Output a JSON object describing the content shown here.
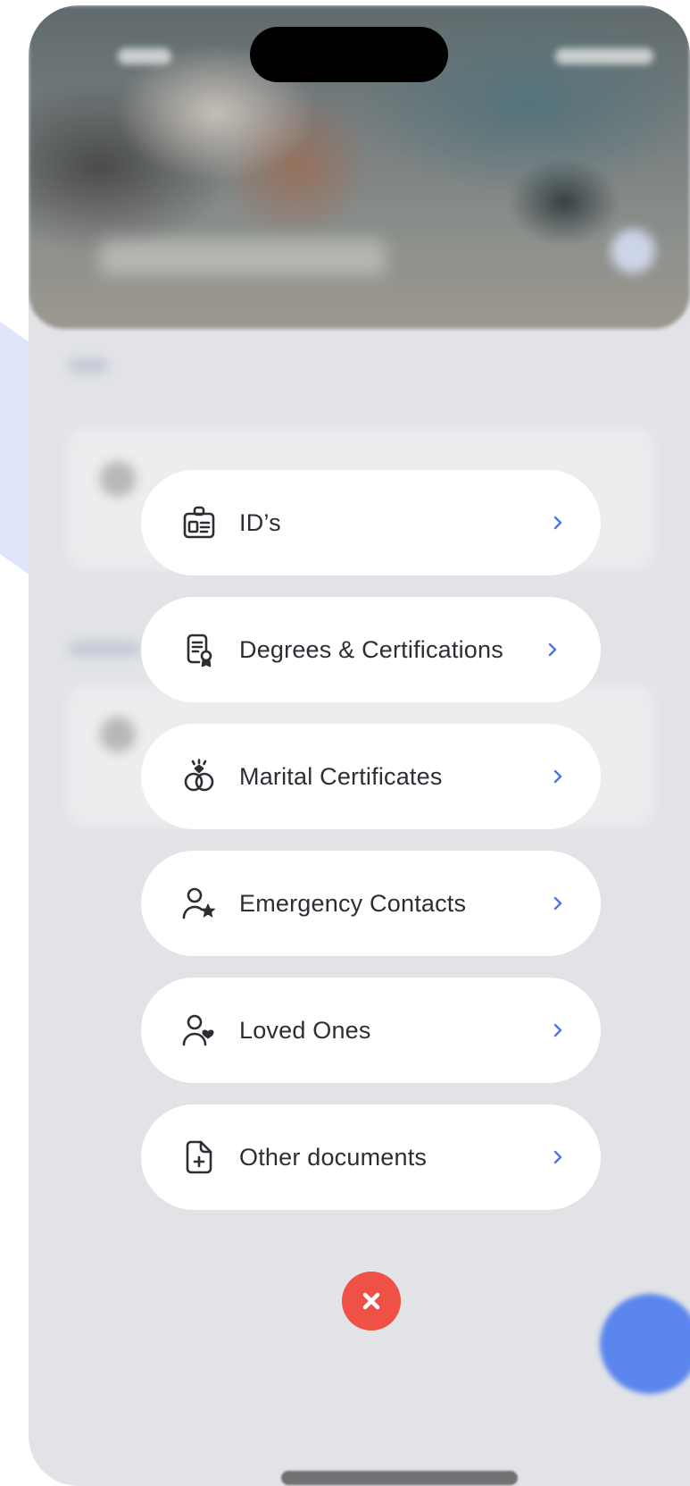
{
  "menu": {
    "items": [
      {
        "label": "ID’s",
        "icon": "id-badge-icon"
      },
      {
        "label": "Degrees & Certifications",
        "icon": "certificate-icon"
      },
      {
        "label": "Marital Certificates",
        "icon": "rings-icon"
      },
      {
        "label": "Emergency Contacts",
        "icon": "person-star-icon"
      },
      {
        "label": "Loved Ones",
        "icon": "person-heart-icon"
      },
      {
        "label": "Other documents",
        "icon": "document-add-icon"
      }
    ],
    "chevron_icon": "chevron-right-icon"
  },
  "close_button": {
    "icon": "close-icon"
  },
  "colors": {
    "accent": "#4a76e8",
    "close": "#ef5147",
    "fab": "#5b86ee",
    "overlay": "#e1e3e6",
    "text": "#2b2e33"
  }
}
